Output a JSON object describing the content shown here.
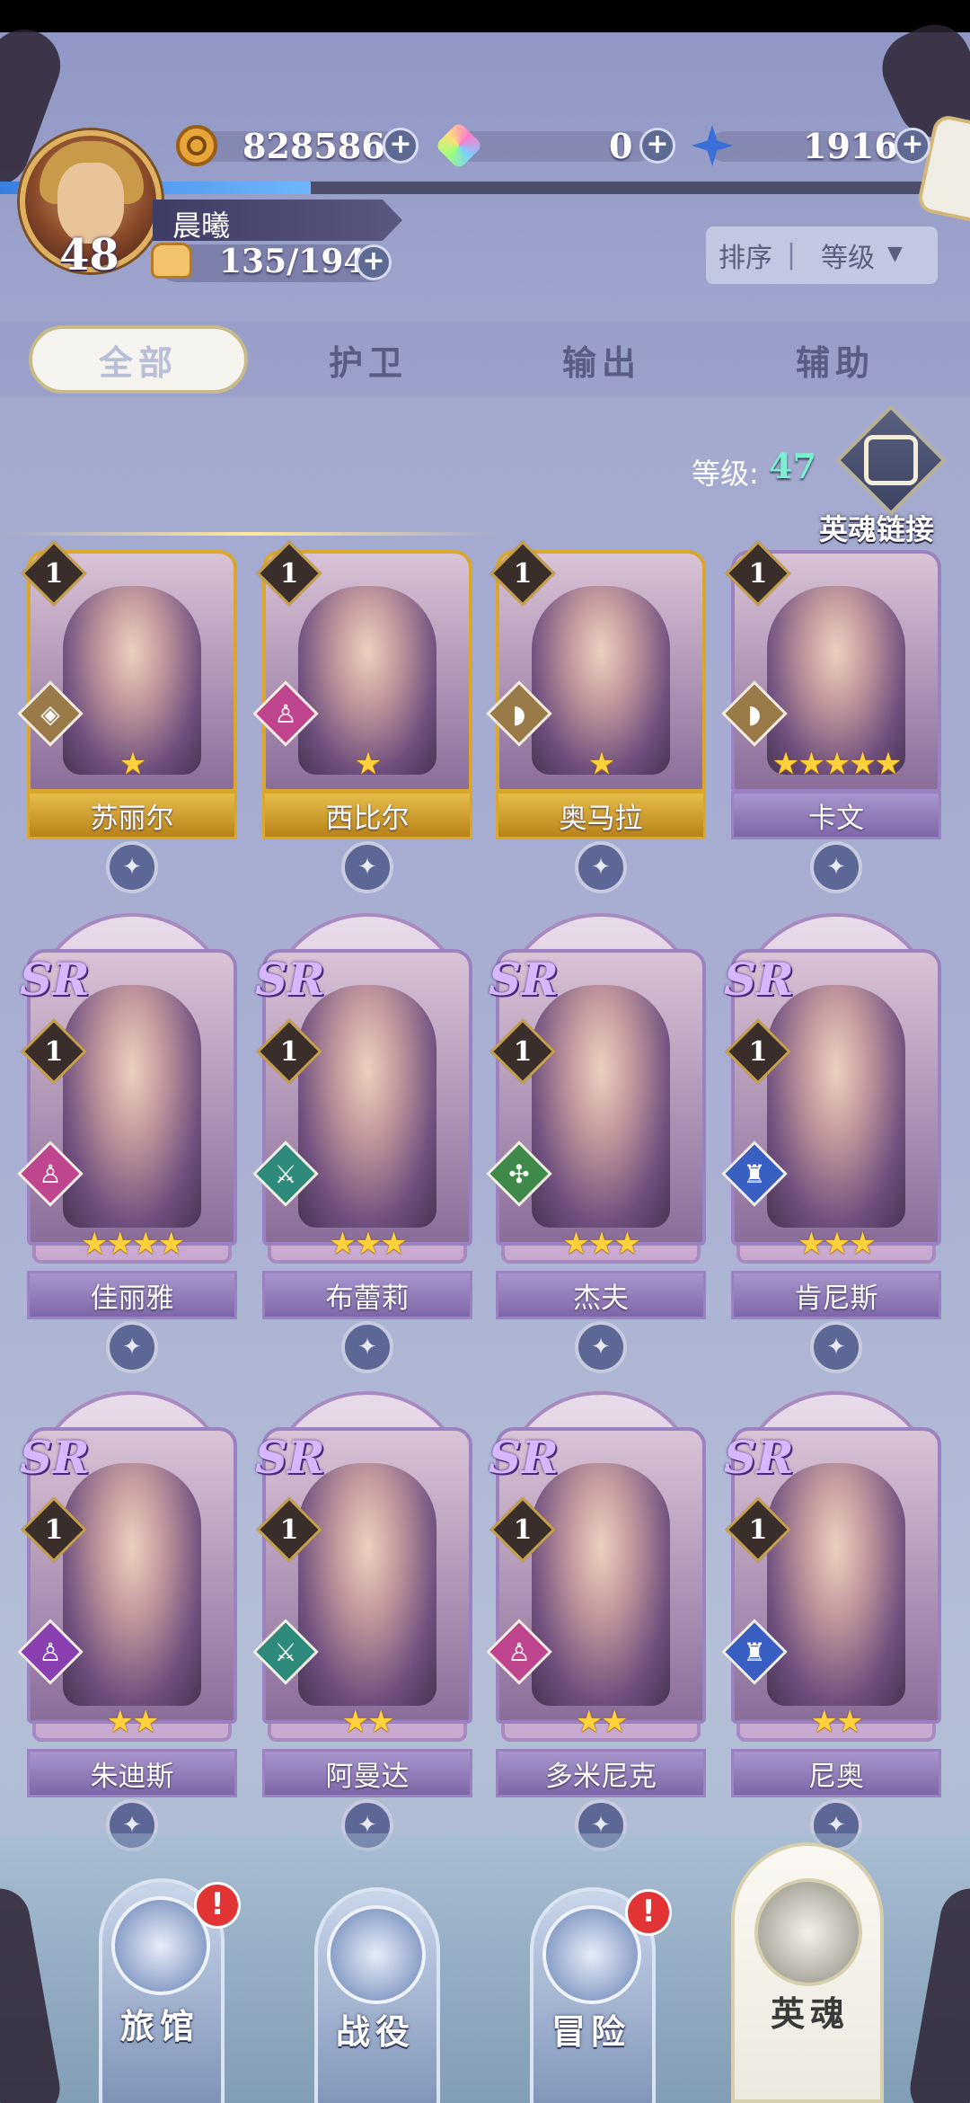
{
  "resources": {
    "gold": "828586",
    "gems": "0",
    "crystal": "1916"
  },
  "player": {
    "name": "晨曦",
    "level": "48",
    "stamina": "135/194"
  },
  "sort": {
    "label": "排序",
    "separator": "|",
    "value": "等级"
  },
  "tabs": [
    {
      "label": "全部",
      "active": true
    },
    {
      "label": "护卫",
      "active": false
    },
    {
      "label": "输出",
      "active": false
    },
    {
      "label": "辅助",
      "active": false
    }
  ],
  "soul_link": {
    "level_label": "等级:",
    "level_value": "47",
    "label": "英魂链接"
  },
  "heroes": [
    {
      "name": "苏丽尔",
      "level": "1",
      "stars": "★",
      "rarity": "",
      "frame": "gold",
      "role_color": "#9b7a4a",
      "role_glyph": "◈"
    },
    {
      "name": "西比尔",
      "level": "1",
      "stars": "★",
      "rarity": "",
      "frame": "gold",
      "role_color": "#c0458f",
      "role_glyph": "♙"
    },
    {
      "name": "奥马拉",
      "level": "1",
      "stars": "★",
      "rarity": "",
      "frame": "gold",
      "role_color": "#9b7a4a",
      "role_glyph": "◗"
    },
    {
      "name": "卡文",
      "level": "1",
      "stars": "★★★★★",
      "rarity": "",
      "frame": "purple",
      "role_color": "#9b7a4a",
      "role_glyph": "◗"
    },
    {
      "name": "佳丽雅",
      "level": "1",
      "stars": "★★★★",
      "rarity": "SR",
      "frame": "purple",
      "role_color": "#c0458f",
      "role_glyph": "♙"
    },
    {
      "name": "布蕾莉",
      "level": "1",
      "stars": "★★★",
      "rarity": "SR",
      "frame": "purple",
      "role_color": "#2e8a7a",
      "role_glyph": "⚔"
    },
    {
      "name": "杰夫",
      "level": "1",
      "stars": "★★★",
      "rarity": "SR",
      "frame": "purple",
      "role_color": "#3f8a4a",
      "role_glyph": "✣"
    },
    {
      "name": "肯尼斯",
      "level": "1",
      "stars": "★★★",
      "rarity": "SR",
      "frame": "purple",
      "role_color": "#3a5fc2",
      "role_glyph": "♜"
    },
    {
      "name": "朱迪斯",
      "level": "1",
      "stars": "★★",
      "rarity": "SR",
      "frame": "purple",
      "role_color": "#8a3fb0",
      "role_glyph": "♙"
    },
    {
      "name": "阿曼达",
      "level": "1",
      "stars": "★★",
      "rarity": "SR",
      "frame": "purple",
      "role_color": "#2e8a7a",
      "role_glyph": "⚔"
    },
    {
      "name": "多米尼克",
      "level": "1",
      "stars": "★★",
      "rarity": "SR",
      "frame": "purple",
      "role_color": "#c0458f",
      "role_glyph": "♙"
    },
    {
      "name": "尼奥",
      "level": "1",
      "stars": "★★",
      "rarity": "SR",
      "frame": "purple",
      "role_color": "#3a5fc2",
      "role_glyph": "♜"
    }
  ],
  "nav": [
    {
      "label": "旅馆",
      "alert": "!"
    },
    {
      "label": "战役",
      "alert": ""
    },
    {
      "label": "冒险",
      "alert": "!"
    },
    {
      "label": "英魂",
      "alert": "",
      "active": true
    }
  ],
  "colors": {
    "gold_frame": "#d9a72c",
    "purple_frame": "#9a82c0",
    "xp_fill": "#3a7fe0",
    "soul_level": "#7af0d0"
  },
  "xp_fraction": 0.32
}
